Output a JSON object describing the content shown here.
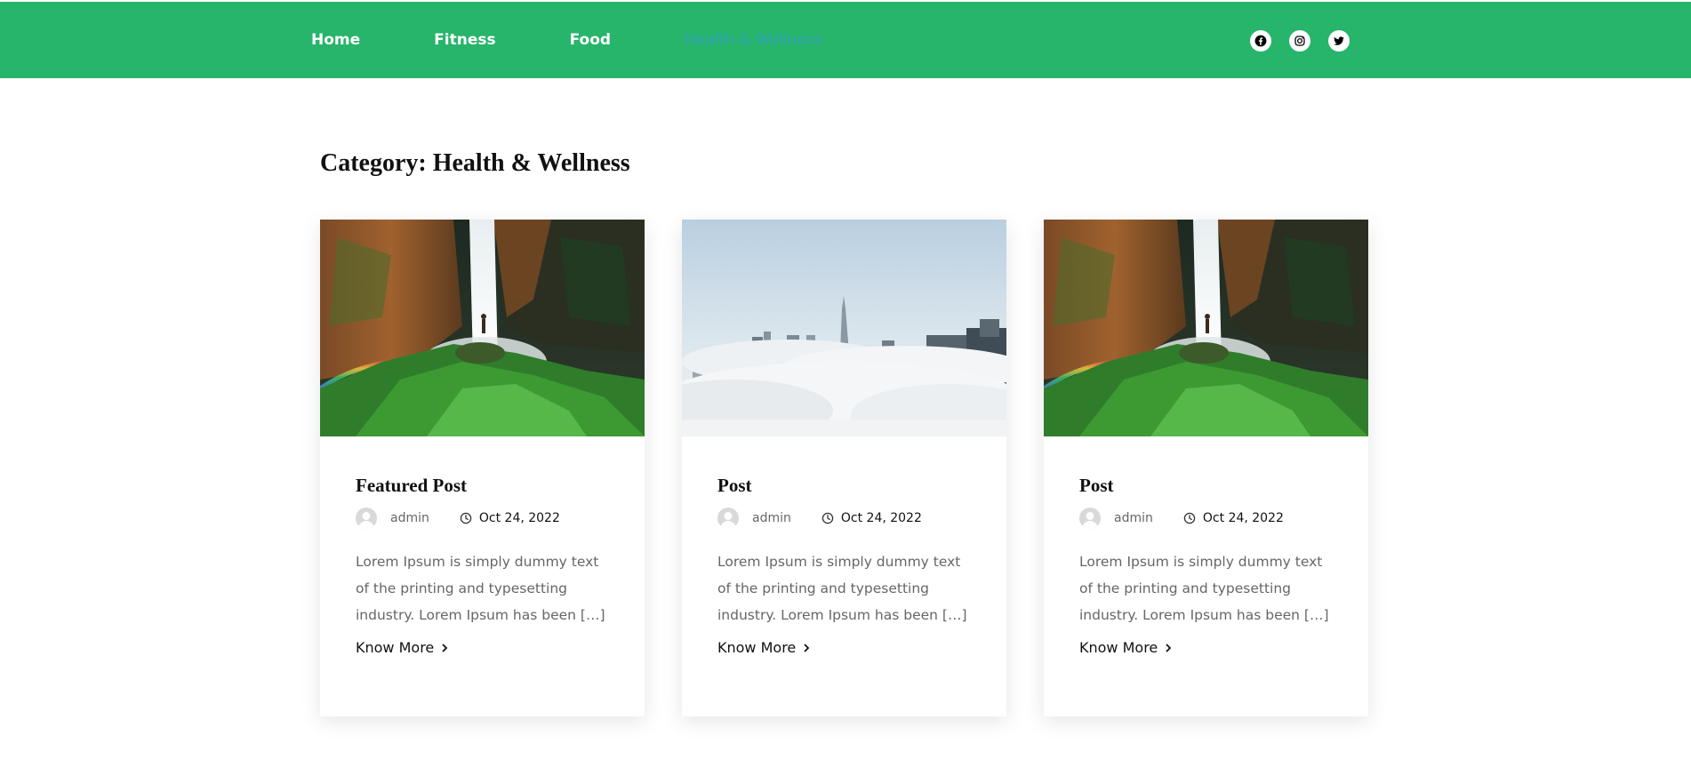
{
  "header": {
    "nav": [
      {
        "label": "Home"
      },
      {
        "label": "Fitness"
      },
      {
        "label": "Food"
      },
      {
        "label": "Health & Wellness"
      }
    ],
    "social": [
      "facebook-icon",
      "instagram-icon",
      "twitter-icon"
    ],
    "bg_color": "#27b46b",
    "active_color": "#2fa3b8"
  },
  "page": {
    "title": "Category: Health & Wellness"
  },
  "posts": [
    {
      "image": "waterfall-image",
      "title": "Featured Post",
      "author": "admin",
      "date": "Oct 24, 2022",
      "excerpt": "Lorem Ipsum is simply dummy text of the printing and typesetting industry. Lorem Ipsum has been […]",
      "link": "Know More"
    },
    {
      "image": "city-clouds-image",
      "title": "Post",
      "author": "admin",
      "date": "Oct 24, 2022",
      "excerpt": "Lorem Ipsum is simply dummy text of the printing and typesetting industry. Lorem Ipsum has been […]",
      "link": "Know More"
    },
    {
      "image": "waterfall-image",
      "title": "Post",
      "author": "admin",
      "date": "Oct 24, 2022",
      "excerpt": "Lorem Ipsum is simply dummy text of the printing and typesetting industry. Lorem Ipsum has been […]",
      "link": "Know More"
    }
  ]
}
